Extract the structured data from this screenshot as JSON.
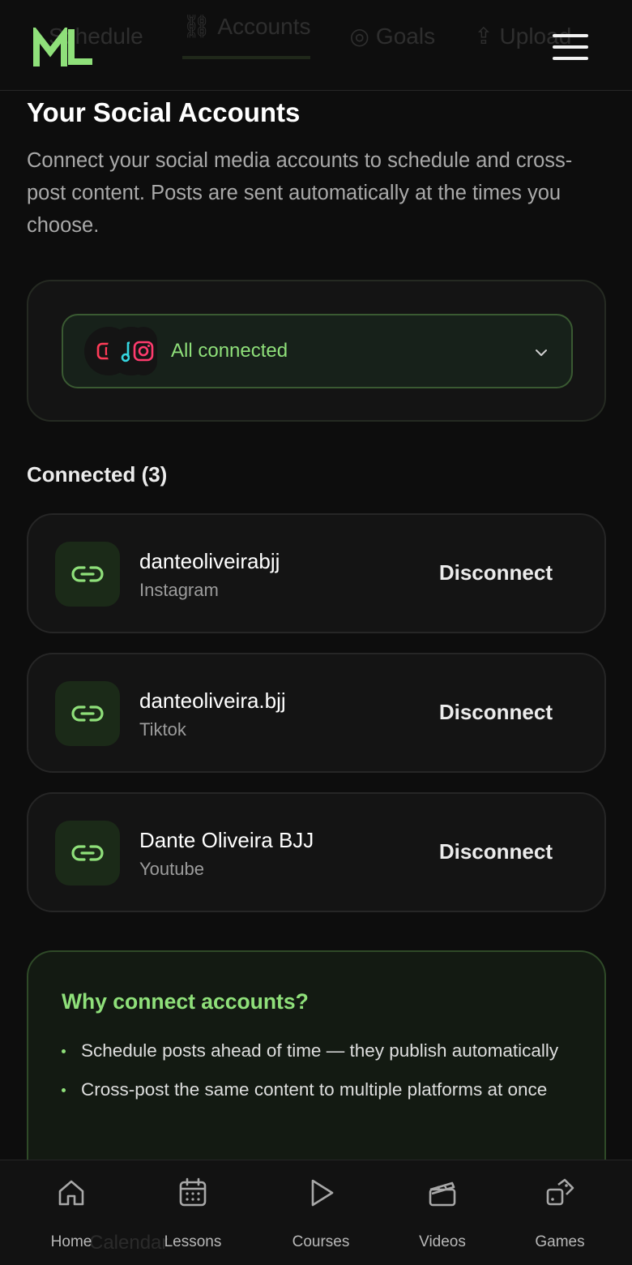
{
  "header": {
    "ghost_tabs": [
      "Schedule",
      "Accounts",
      "Goals",
      "Upload"
    ],
    "logo_text": "ML",
    "menu_icon": "hamburger-icon"
  },
  "page": {
    "title": "Your Social Accounts",
    "description": "Connect your social media accounts to schedule and cross-post content. Posts are sent automatically at the times you choose."
  },
  "selector": {
    "label": "All connected",
    "icons": [
      "youtube-icon",
      "tiktok-icon",
      "instagram-icon"
    ]
  },
  "connected": {
    "title": "Connected (3)",
    "accounts": [
      {
        "name": "danteoliveirabjj",
        "platform": "Instagram",
        "action": "Disconnect"
      },
      {
        "name": "danteoliveira.bjj",
        "platform": "Tiktok",
        "action": "Disconnect"
      },
      {
        "name": "Dante Oliveira BJJ",
        "platform": "Youtube",
        "action": "Disconnect"
      }
    ]
  },
  "why": {
    "title": "Why connect accounts?",
    "items": [
      "Schedule posts ahead of time — they publish automatically",
      "Cross-post the same content to multiple platforms at once"
    ]
  },
  "bottom_nav": {
    "ghost_label": "Calendar",
    "items": [
      {
        "label": "Home",
        "icon": "home-icon"
      },
      {
        "label": "Lessons",
        "icon": "calendar-icon"
      },
      {
        "label": "Courses",
        "icon": "play-icon"
      },
      {
        "label": "Videos",
        "icon": "clapperboard-icon"
      },
      {
        "label": "Games",
        "icon": "dice-icon"
      }
    ]
  },
  "colors": {
    "accent": "#8fe07a",
    "background": "#0d0d0d",
    "card": "#141414"
  }
}
